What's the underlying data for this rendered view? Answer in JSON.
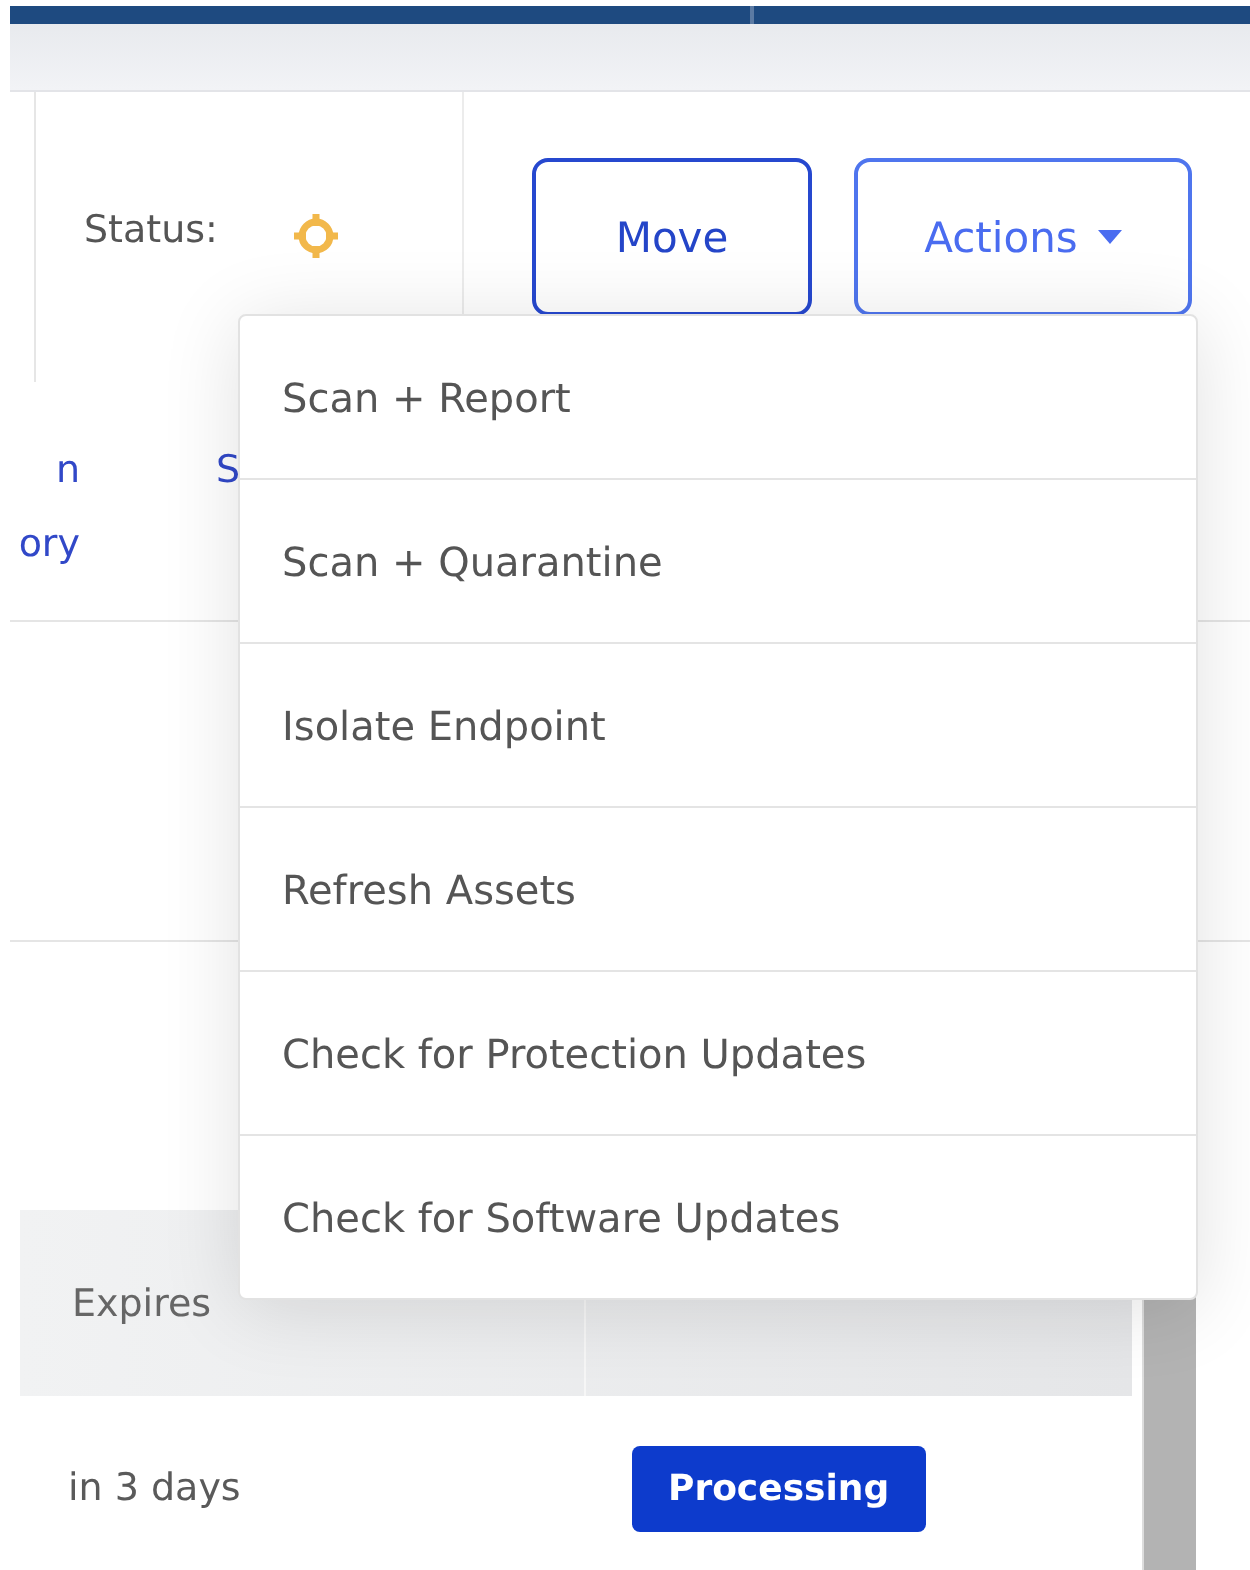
{
  "status": {
    "label": "Status:"
  },
  "buttons": [
    {
      "label": "Move",
      "kind": "plain"
    },
    {
      "label": "Actions",
      "kind": "dropdown",
      "expanded": true
    }
  ],
  "links": [
    {
      "lines": [
        "n",
        "ory"
      ]
    },
    {
      "lines": [
        "S"
      ]
    }
  ],
  "menu": {
    "items": [
      "Scan + Report",
      "Scan + Quarantine",
      "Isolate Endpoint",
      "Refresh Assets",
      "Check for Protection Updates",
      "Check for Software Updates"
    ]
  },
  "table": {
    "columns": [
      "Expires"
    ],
    "rows": [
      {
        "expires": "in 3 days",
        "status": "Processing"
      }
    ]
  }
}
